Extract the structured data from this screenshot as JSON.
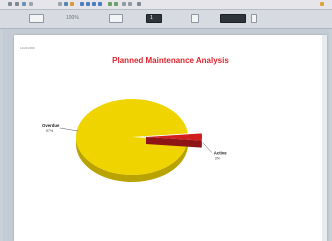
{
  "app": {
    "toolbar": {
      "zoom_value": "100%",
      "page_value": "1",
      "search_placeholder": ""
    }
  },
  "document": {
    "date": "11/21/2009"
  },
  "chart_data": {
    "type": "pie",
    "title": "Planned Maintenance Analysis",
    "slices": [
      {
        "name": "Overdue",
        "label_value": "97%",
        "value": 97,
        "color": "#f0d400",
        "side_color": "#b8a300"
      },
      {
        "name": "Active",
        "label_value": "3%",
        "value": 3,
        "color": "#d11f1f",
        "side_color": "#8e1515"
      }
    ]
  }
}
